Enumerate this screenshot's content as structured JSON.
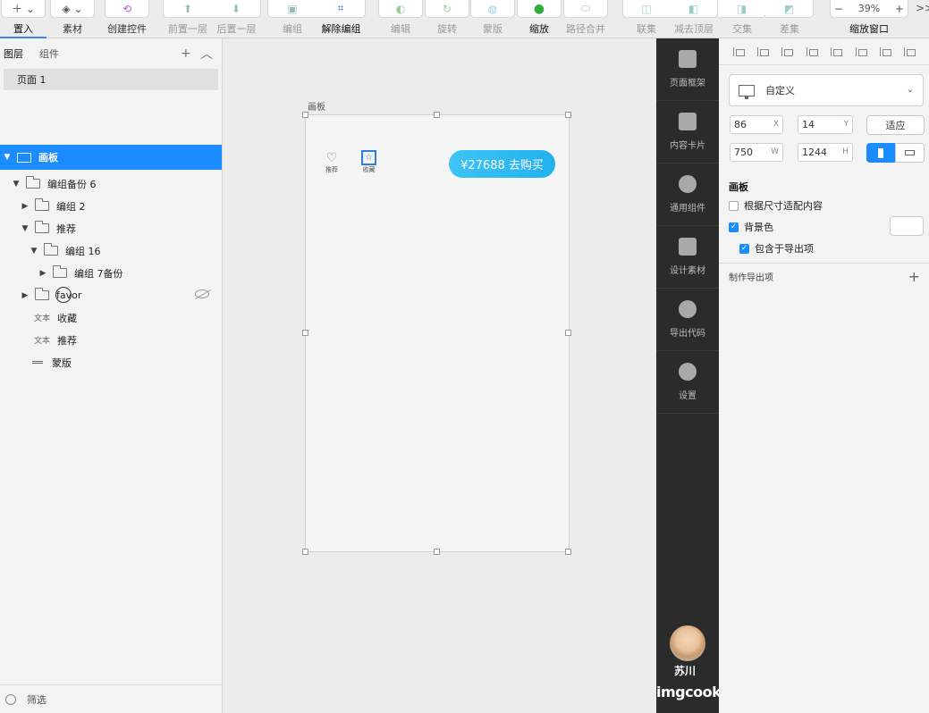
{
  "toolbar": {
    "items": [
      {
        "label": "置入",
        "icon": "plus-icon",
        "state": "selected"
      },
      {
        "label": "素材",
        "icon": "layers-icon",
        "state": "normal"
      },
      {
        "label": "创建控件",
        "icon": "component-icon",
        "state": "normal"
      },
      {
        "label": "前置一层",
        "icon": "bring-forward-icon",
        "state": "disabled"
      },
      {
        "label": "后置一层",
        "icon": "send-backward-icon",
        "state": "disabled"
      },
      {
        "label": "编组",
        "icon": "group-icon",
        "state": "disabled"
      },
      {
        "label": "解除编组",
        "icon": "ungroup-icon",
        "state": "normal"
      },
      {
        "label": "编辑",
        "icon": "edit-icon",
        "state": "disabled"
      },
      {
        "label": "旋转",
        "icon": "rotate-icon",
        "state": "disabled"
      },
      {
        "label": "蒙版",
        "icon": "mask-icon",
        "state": "disabled"
      },
      {
        "label": "缩放",
        "icon": "scale-icon",
        "state": "normal"
      },
      {
        "label": "路径合并",
        "icon": "path-merge-icon",
        "state": "disabled"
      },
      {
        "label": "联集",
        "icon": "union-icon",
        "state": "disabled"
      },
      {
        "label": "减去顶层",
        "icon": "subtract-icon",
        "state": "disabled"
      },
      {
        "label": "交集",
        "icon": "intersect-icon",
        "state": "disabled"
      },
      {
        "label": "差集",
        "icon": "difference-icon",
        "state": "disabled"
      }
    ],
    "zoom": {
      "value": "39%",
      "label": "缩放窗口",
      "minus": "−",
      "plus": "+"
    },
    "overflow": ">>"
  },
  "left_panel": {
    "tabs": [
      "图层",
      "组件"
    ],
    "add": "+",
    "collapse": "^",
    "page": "页面 1",
    "layers": [
      {
        "name": "画板",
        "kind": "artboard",
        "indent": 0,
        "expanded": true,
        "selected": true
      },
      {
        "name": "编组备份 6",
        "kind": "folder",
        "indent": 1,
        "expanded": true
      },
      {
        "name": "编组 2",
        "kind": "folder",
        "indent": 2,
        "expanded": false
      },
      {
        "name": "推荐",
        "kind": "folder",
        "indent": 2,
        "expanded": true
      },
      {
        "name": "编组 16",
        "kind": "folder",
        "indent": 3,
        "expanded": true
      },
      {
        "name": "编组 7备份",
        "kind": "folder",
        "indent": 4,
        "expanded": false
      },
      {
        "name": "favor",
        "kind": "folder",
        "indent": 2,
        "expanded": false,
        "hidden": true
      },
      {
        "name": "收藏",
        "kind": "text",
        "tag": "文本",
        "indent": 3
      },
      {
        "name": "推荐",
        "kind": "text",
        "tag": "文本",
        "indent": 3
      },
      {
        "name": "蒙版",
        "kind": "mask",
        "indent": 3
      }
    ],
    "filter": "筛选"
  },
  "canvas": {
    "artboard_label": "画板",
    "icons": [
      {
        "icon": "heart-icon",
        "label": "推荐"
      },
      {
        "icon": "star-icon",
        "label": "收藏"
      }
    ],
    "buy_button": "¥27688 去购买",
    "colors": {
      "buy": "#22b0f0"
    }
  },
  "dark_sidebar": {
    "items": [
      {
        "label": "页面框架",
        "icon": "page-frame-icon"
      },
      {
        "label": "内容卡片",
        "icon": "content-card-icon"
      },
      {
        "label": "通用组件",
        "icon": "puzzle-icon"
      },
      {
        "label": "设计素材",
        "icon": "image-icon"
      },
      {
        "label": "导出代码",
        "icon": "export-code-icon"
      },
      {
        "label": "设置",
        "icon": "gear-icon"
      }
    ],
    "user": "苏川",
    "brand": "imgcook"
  },
  "right_panel": {
    "preset": "自定义",
    "x": "86",
    "x_label": "X",
    "y": "14",
    "y_label": "Y",
    "w": "750",
    "w_label": "W",
    "h": "1244",
    "h_label": "H",
    "fit_button": "适应",
    "section": "画板",
    "fit_content": {
      "label": "根据尺寸适配内容",
      "checked": false
    },
    "background": {
      "label": "背景色",
      "checked": true
    },
    "include_export": {
      "label": "包含于导出项",
      "checked": true
    },
    "export_label": "制作导出项",
    "export_add": "+",
    "accent": "#1a8cff"
  }
}
